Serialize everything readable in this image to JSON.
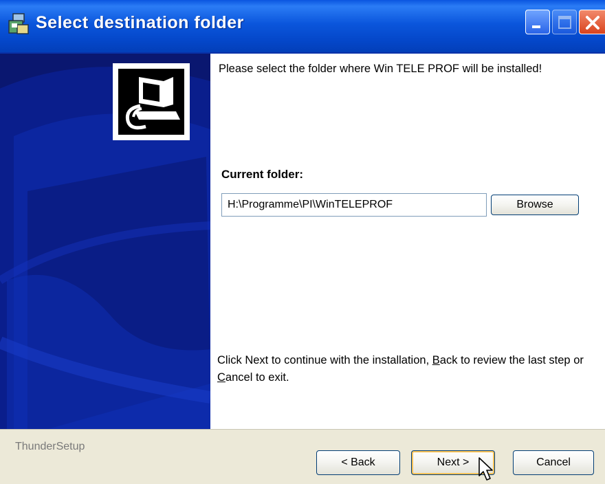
{
  "window": {
    "title": "Select destination folder",
    "icons": {
      "app": "installer-icon",
      "minimize": "minimize-icon",
      "maximize": "maximize-icon",
      "close": "close-icon"
    },
    "colors": {
      "titlebar": "#0a55e0",
      "banner": "#0a1770",
      "close": "#d9431d",
      "chrome": "#ece9d8"
    }
  },
  "content": {
    "intro": "Please select the folder where Win TELE PROF will be installed!",
    "folder_label": "Current folder:",
    "folder_path": "H:\\Programme\\PI\\WinTELEPROF",
    "browse_label": "Browse",
    "footer": {
      "part1": "Click Next to continue with the installation, ",
      "back_key": "B",
      "back_rest": "ack to review the last step or ",
      "cancel_key": "C",
      "cancel_rest": "ancel to exit."
    }
  },
  "bottom": {
    "brand": "ThunderSetup",
    "back_label": "< Back",
    "next_label": "Next >",
    "cancel_label": "Cancel"
  }
}
